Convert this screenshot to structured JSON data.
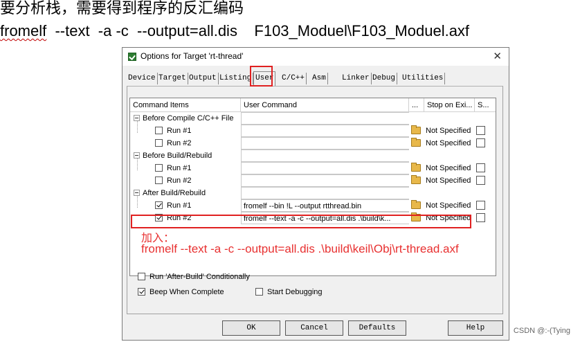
{
  "captions": {
    "line1": "要分析栈，需要得到程序的反汇编码",
    "line2_cmd": "fromelf",
    "line2_rest": "  --text  -a -c  --output=all.dis    F103_Moduel\\F103_Moduel.axf"
  },
  "dialog": {
    "title": "Options for Target 'rt-thread'",
    "close_glyph": "✕",
    "tabs": [
      "Device",
      "Target",
      "Output",
      "Listing",
      "User",
      "C/C++",
      "Asm",
      "Linker",
      "Debug",
      "Utilities"
    ],
    "active_tab": "User",
    "columns": [
      "Command Items",
      "User Command",
      "...",
      "Stop on Exi...",
      "S..."
    ],
    "groups": [
      {
        "label": "Before Compile C/C++ File",
        "runs": [
          {
            "label": "Run #1",
            "checked": false,
            "command": "",
            "stop": "Not Specified"
          },
          {
            "label": "Run #2",
            "checked": false,
            "command": "",
            "stop": "Not Specified"
          }
        ]
      },
      {
        "label": "Before Build/Rebuild",
        "runs": [
          {
            "label": "Run #1",
            "checked": false,
            "command": "",
            "stop": "Not Specified"
          },
          {
            "label": "Run #2",
            "checked": false,
            "command": "",
            "stop": "Not Specified"
          }
        ]
      },
      {
        "label": "After Build/Rebuild",
        "runs": [
          {
            "label": "Run #1",
            "checked": true,
            "command": "fromelf --bin !L --output rtthread.bin",
            "stop": "Not Specified"
          },
          {
            "label": "Run #2",
            "checked": true,
            "command": "fromelf --text -a -c --output=all.dis  .\\build\\k...",
            "stop": "Not Specified"
          }
        ]
      }
    ],
    "annotation_label": "加入：",
    "annotation_cmd": "fromelf  --text  -a -c  --output=all.dis   .\\build\\keil\\Obj\\rt-thread.axf",
    "options": {
      "run_after_build": {
        "label": "Run 'After-Build' Conditionally",
        "checked": false
      },
      "beep": {
        "label": "Beep When Complete",
        "checked": true
      },
      "start_debugging": {
        "label": "Start Debugging",
        "checked": false
      }
    },
    "buttons": {
      "ok": "OK",
      "cancel": "Cancel",
      "defaults": "Defaults",
      "help": "Help"
    }
  },
  "watermark": "CSDN @:-(Tying",
  "colors": {
    "highlight": "#e02020",
    "annotation": "#e83030"
  }
}
